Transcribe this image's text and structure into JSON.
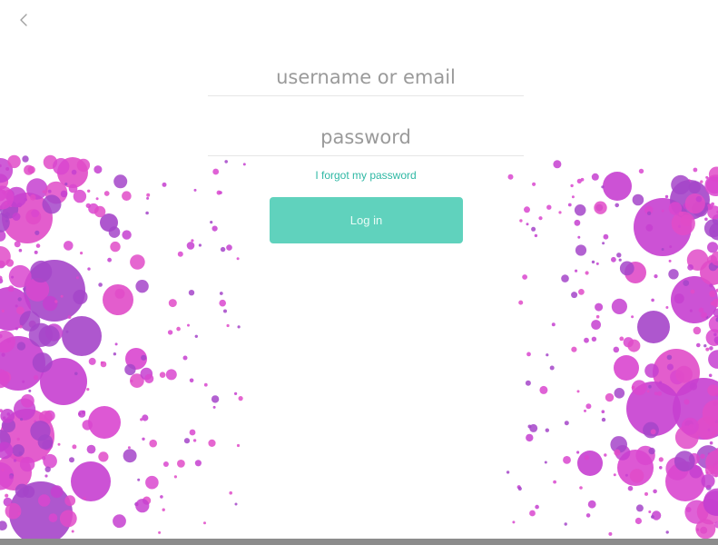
{
  "nav": {
    "back_icon": "chevron-left-icon"
  },
  "form": {
    "username_placeholder": "username or email",
    "username_value": "",
    "password_placeholder": "password",
    "password_value": "",
    "forgot_label": "I forgot my password",
    "login_label": "Log in"
  },
  "theme": {
    "accent": "#60d2bd",
    "link": "#2fb8a4",
    "dot_colors": [
      "#c63fd0",
      "#e04bc8",
      "#a545c9",
      "#d946cf"
    ],
    "background": "#ffffff",
    "bottom_bar": "#8c8c8c"
  }
}
